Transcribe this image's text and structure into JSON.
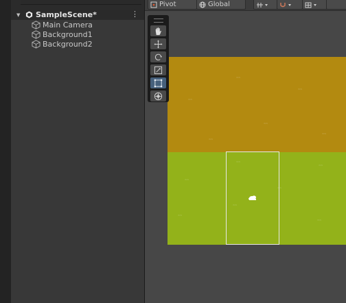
{
  "hierarchy": {
    "scene": {
      "name": "SampleScene*",
      "menu_label": "⋮"
    },
    "objects": [
      {
        "label": "Main Camera",
        "icon": "gameobject-cube-icon"
      },
      {
        "label": "Background1",
        "icon": "gameobject-cube-icon"
      },
      {
        "label": "Background2",
        "icon": "gameobject-cube-icon"
      }
    ]
  },
  "scene_view": {
    "toolbar": {
      "pivot_label": "Pivot",
      "global_label": "Global"
    },
    "tools": [
      {
        "name": "hand-tool",
        "icon": "hand-icon",
        "active": false
      },
      {
        "name": "move-tool",
        "icon": "move-arrows-icon",
        "active": false
      },
      {
        "name": "rotate-tool",
        "icon": "rotate-icon",
        "active": false
      },
      {
        "name": "scale-tool",
        "icon": "scale-icon",
        "active": false
      },
      {
        "name": "rect-tool",
        "icon": "rect-transform-icon",
        "active": true
      },
      {
        "name": "transform-tool",
        "icon": "transform-icon",
        "active": false
      }
    ],
    "colors": {
      "background1": "#b38a10",
      "background2": "#93b21a",
      "camera_frame": "#e8e8e8",
      "active_tool": "#46607c"
    }
  }
}
